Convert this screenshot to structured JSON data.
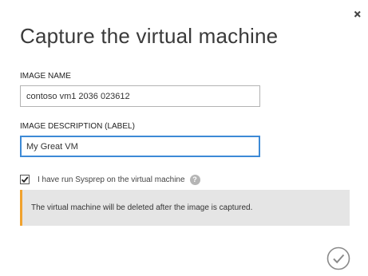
{
  "dialog": {
    "title": "Capture the virtual machine",
    "close_icon": "close-icon"
  },
  "image_name": {
    "label": "IMAGE NAME",
    "value": "contoso vm1 2036 023612"
  },
  "image_description": {
    "label": "IMAGE DESCRIPTION (LABEL)",
    "value": "My Great VM"
  },
  "sysprep": {
    "checked": true,
    "label": "I have run Sysprep on the virtual machine",
    "help_icon": "question-circle-icon"
  },
  "notice": {
    "text": "The virtual machine will be deleted after the image is captured.",
    "accent_color": "#f0a22e"
  },
  "footer": {
    "confirm_icon": "checkmark-circle-icon"
  },
  "colors": {
    "focus_border": "#3d8ad6",
    "notice_background": "#e5e5e5"
  }
}
